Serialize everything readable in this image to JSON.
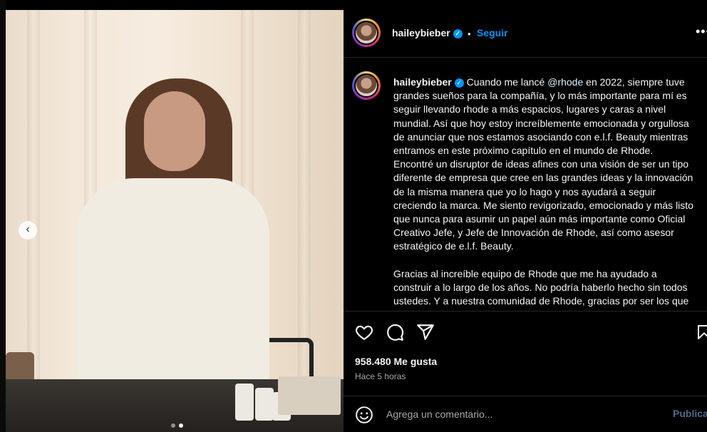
{
  "post": {
    "username": "haileybieber",
    "follow_label": "Seguir",
    "separator": "•",
    "more_label": "•••",
    "carousel_prev": "‹",
    "carousel": {
      "slide_count": 2,
      "active_index": 1
    }
  },
  "caption": {
    "username": "haileybieber",
    "lines": [
      "Cuando me lancé ",
      "grandes sueños para la compañía, y lo más importante para mí es",
      "seguir llevando rhode a más espacios, lugares y caras a nivel",
      "mundial. Así que hoy estoy increíblemente emocionada y orgullosa",
      "de anunciar que nos estamos asociando con e.l.f. Beauty mientras",
      "entramos en este próximo capítulo en el mundo de Rhode.",
      "Encontré un disruptor de ideas afines con una visión de ser un tipo",
      "diferente de empresa que cree en las grandes ideas y la innovación",
      "de la misma manera que yo lo hago y nos ayudará a seguir",
      "creciendo la marca. Me siento revigorizado, emocionado y más listo",
      "que nunca para asumir un papel aún más importante como Oficial",
      "Creativo Jefe, y Jefe de Innovación de Rhode, así como asesor",
      "estratégico de e.l.f. Beauty.",
      "Gracias al increíble equipo de Rhode que me ha ayudado a",
      "construir a lo largo de los años. No podría haberlo hecho sin todos",
      "ustedes. Y a nuestra comunidad de Rhode, gracias por ser los que"
    ],
    "mention": "@rhode",
    "line1_rest": " en 2022, siempre tuve"
  },
  "engagement": {
    "likes": "958.480 Me gusta",
    "time": "Hace 5 horas"
  },
  "comment": {
    "placeholder": "Agrega un comentario...",
    "publish_label": "Publicar"
  },
  "icons": {
    "like": "heart-icon",
    "comment": "comment-icon",
    "share": "share-icon",
    "save": "bookmark-icon",
    "emoji": "emoji-icon"
  },
  "colors": {
    "accent": "#0095f6",
    "background": "#000000",
    "text": "#f5f5f5",
    "muted": "#a8a8a8"
  }
}
